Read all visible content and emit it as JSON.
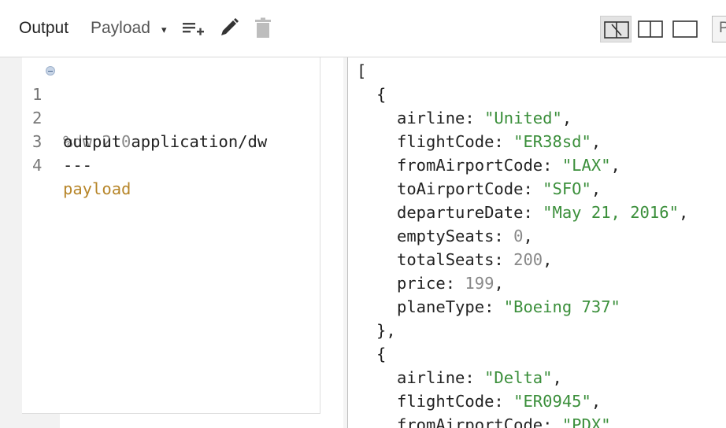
{
  "toolbar": {
    "output_label": "Output",
    "payload_label": "Payload",
    "dropdown_caret": "▾",
    "cut_label": "P",
    "icons": [
      "add-list-icon",
      "pencil-icon",
      "trash-icon"
    ],
    "view_modes": [
      "split-view-icon",
      "two-column-icon",
      "single-column-icon"
    ]
  },
  "editor": {
    "lines": [
      {
        "number": "1",
        "text": "%dw 2.0"
      },
      {
        "number": "2",
        "text": "output application/dw"
      },
      {
        "number": "3",
        "text": "---"
      },
      {
        "number": "4",
        "text": "payload"
      }
    ]
  },
  "output": {
    "open_bracket": "[",
    "records": [
      {
        "airline": "\"United\"",
        "flightCode": "\"ER38sd\"",
        "fromAirportCode": "\"LAX\"",
        "toAirportCode": "\"SFO\"",
        "departureDate": "\"May 21, 2016\"",
        "emptySeats": "0",
        "totalSeats": "200",
        "price": "199",
        "planeType": "\"Boeing 737\""
      },
      {
        "airline": "\"Delta\"",
        "flightCode": "\"ER0945\"",
        "fromAirportCode": "\"PDX\""
      }
    ],
    "keys": {
      "airline": "airline",
      "flightCode": "flightCode",
      "fromAirportCode": "fromAirportCode",
      "toAirportCode": "toAirportCode",
      "departureDate": "departureDate",
      "emptySeats": "emptySeats",
      "totalSeats": "totalSeats",
      "price": "price",
      "planeType": "planeType"
    }
  },
  "colors": {
    "string": "#3b8f3b",
    "number": "#888888",
    "keyword": "#b7862a"
  }
}
